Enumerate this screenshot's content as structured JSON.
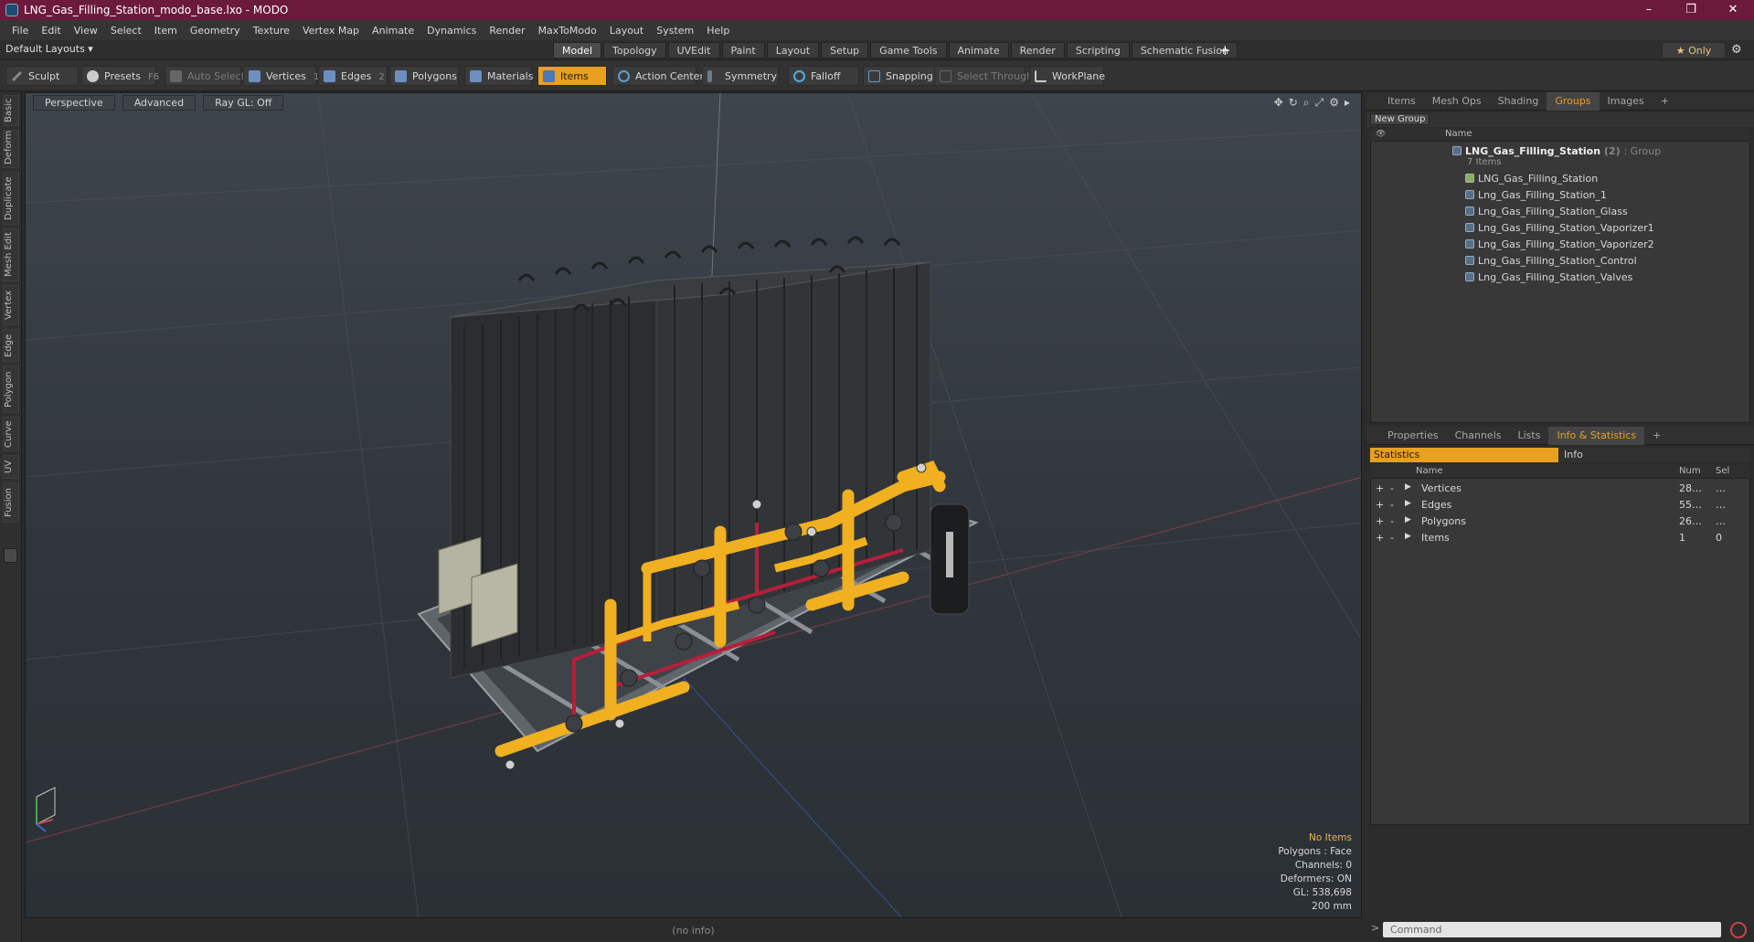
{
  "window": {
    "title": "LNG_Gas_Filling_Station_modo_base.lxo - MODO",
    "controls": [
      "–",
      "❐",
      "✕"
    ]
  },
  "menu": [
    "File",
    "Edit",
    "View",
    "Select",
    "Item",
    "Geometry",
    "Texture",
    "Vertex Map",
    "Animate",
    "Dynamics",
    "Render",
    "MaxToModo",
    "Layout",
    "System",
    "Help"
  ],
  "layoutbar": {
    "layouts_label": "Default Layouts ▾",
    "tabs": [
      "Model",
      "Topology",
      "UVEdit",
      "Paint",
      "Layout",
      "Setup",
      "Game Tools",
      "Animate",
      "Render",
      "Scripting",
      "Schematic Fusion"
    ],
    "active_tab": "Model",
    "add": "+",
    "only_label": "★ Only"
  },
  "toolbar": {
    "sculpt": "Sculpt",
    "presets": "Presets",
    "presets_key": "F6",
    "auto_select": "Auto Select",
    "vertices": "Vertices",
    "vertices_key": "1",
    "edges": "Edges",
    "edges_key": "2",
    "polygons": "Polygons",
    "materials": "Materials",
    "items": "Items",
    "action_center": "Action Center",
    "symmetry": "Symmetry",
    "falloff": "Falloff",
    "snapping": "Snapping",
    "select_through": "Select Through",
    "workplane": "WorkPlane"
  },
  "left_tabs": [
    "Basic",
    "Deform",
    "Duplicate",
    "Mesh Edit",
    "Vertex",
    "Edge",
    "Polygon",
    "Curve",
    "UV",
    "Fusion"
  ],
  "viewport": {
    "view": "Perspective",
    "shading": "Advanced",
    "raygl": "Ray GL: Off",
    "stats": {
      "items": "No Items",
      "polygons": "Polygons : Face",
      "channels": "Channels: 0",
      "deformers": "Deformers: ON",
      "gl": "GL: 538,698",
      "scale": "200 mm"
    }
  },
  "status": "(no info)",
  "top_panel": {
    "tabs": [
      "Items",
      "Mesh Ops",
      "Shading",
      "Groups",
      "Images"
    ],
    "active_tab": "Groups",
    "new_group": "New Group",
    "name_header": "Name",
    "group": {
      "name": "LNG_Gas_Filling_Station",
      "count": "(2)",
      "type": ": Group",
      "items_count": "7 Items"
    },
    "children": [
      "LNG_Gas_Filling_Station",
      "Lng_Gas_Filling_Station_1",
      "Lng_Gas_Filling_Station_Glass",
      "Lng_Gas_Filling_Station_Vaporizer1",
      "Lng_Gas_Filling_Station_Vaporizer2",
      "Lng_Gas_Filling_Station_Control",
      "Lng_Gas_Filling_Station_Valves"
    ]
  },
  "bottom_panel": {
    "tabs": [
      "Properties",
      "Channels",
      "Lists",
      "Info & Statistics"
    ],
    "active_tab": "Info & Statistics",
    "subtabs": [
      "Statistics",
      "Info"
    ],
    "headers": {
      "name": "Name",
      "num": "Num",
      "sel": "Sel"
    },
    "rows": [
      {
        "name": "Vertices",
        "num": "28…",
        "sel": "…"
      },
      {
        "name": "Edges",
        "num": "55…",
        "sel": "…"
      },
      {
        "name": "Polygons",
        "num": "26…",
        "sel": "…"
      },
      {
        "name": "Items",
        "num": "1",
        "sel": "0"
      }
    ]
  },
  "command": {
    "placeholder": "Command"
  },
  "colors": {
    "titlebar": "#6b1a3c",
    "accent": "#e8a020",
    "pipe": "#f0b020",
    "red_pipe": "#b81e3a"
  }
}
